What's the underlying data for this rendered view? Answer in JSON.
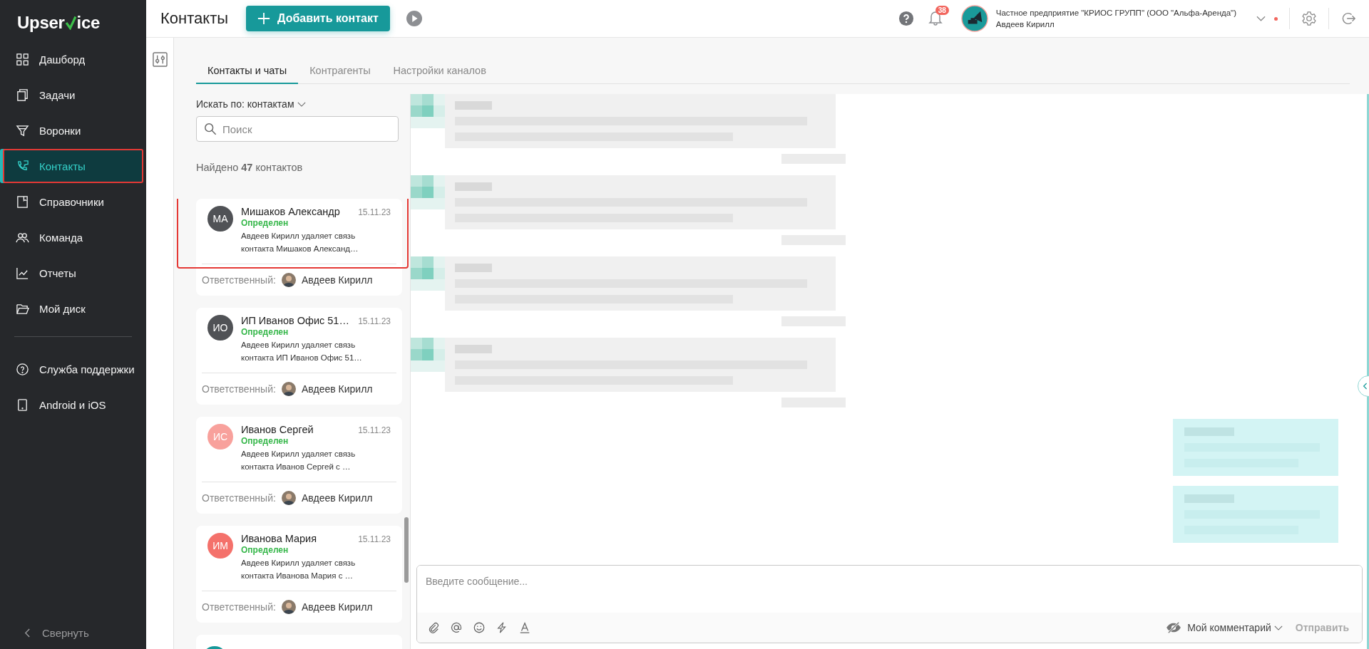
{
  "logo": {
    "before": "Upser",
    "after": "ice"
  },
  "sidebar": {
    "items": [
      {
        "label": "Дашборд",
        "selected": false,
        "highlighted": false
      },
      {
        "label": "Задачи",
        "selected": false,
        "highlighted": false
      },
      {
        "label": "Воронки",
        "selected": false,
        "highlighted": false
      },
      {
        "label": "Контакты",
        "selected": true,
        "highlighted": true
      },
      {
        "label": "Справочники",
        "selected": false,
        "highlighted": false
      },
      {
        "label": "Команда",
        "selected": false,
        "highlighted": false
      },
      {
        "label": "Отчеты",
        "selected": false,
        "highlighted": false
      },
      {
        "label": "Мой диск",
        "selected": false,
        "highlighted": false
      }
    ],
    "bottom_items": [
      {
        "label": "Служба поддержки",
        "selected": false,
        "highlighted": false
      },
      {
        "label": "Android и iOS",
        "selected": false,
        "highlighted": false
      }
    ],
    "collapse": "Свернуть"
  },
  "header": {
    "title": "Контакты",
    "add_button": "Добавить контакт",
    "notifications": "38",
    "company": "Частное предприятие \"КРИОС ГРУПП\" (ООО \"Альфа-Аренда\")",
    "user": "Авдеев Кирилл"
  },
  "tabs": [
    {
      "label": "Контакты и чаты",
      "selected": true
    },
    {
      "label": "Контрагенты",
      "selected": false
    },
    {
      "label": "Настройки каналов",
      "selected": false
    }
  ],
  "search": {
    "filter_label": "Искать по: контактам",
    "placeholder": "Поиск"
  },
  "found": "Найдено **47** контактов",
  "contacts": [
    {
      "kind": "full",
      "initials": "МА",
      "color": "#505256",
      "name": "Мишаков Александр",
      "date": "15.11.23",
      "status": "Определен",
      "preview": "Авдеев Кирилл удаляет связь контакта Мишаков Александ…",
      "responsible_label": "Ответственный:",
      "responsible": "Авдеев Кирилл",
      "highlighted": true
    },
    {
      "kind": "full",
      "initials": "ИО",
      "color": "#505256",
      "name": "ИП Иванов Офис 51…",
      "date": "15.11.23",
      "status": "Определен",
      "preview": "Авдеев Кирилл удаляет связь контакта ИП Иванов Офис 51…",
      "responsible_label": "Ответственный:",
      "responsible": "Авдеев Кирилл",
      "highlighted": false
    },
    {
      "kind": "full",
      "initials": "ИС",
      "color": "#f8a19c",
      "name": "Иванов Сергей",
      "date": "15.11.23",
      "status": "Определен",
      "preview": "Авдеев Кирилл удаляет связь контакта Иванов Сергей с …",
      "responsible_label": "Ответственный:",
      "responsible": "Авдеев Кирилл",
      "highlighted": false
    },
    {
      "kind": "full",
      "initials": "ИМ",
      "color": "#f4716b",
      "name": "Иванова Мария",
      "date": "15.11.23",
      "status": "Определен",
      "preview": "Авдеев Кирилл удаляет связь контакта Иванова Мария с …",
      "responsible_label": "Ответственный:",
      "responsible": "Авдеев Кирилл",
      "highlighted": false
    },
    {
      "kind": "partial",
      "color": "#17999a"
    }
  ],
  "chat": {
    "messages": [
      {
        "kind": "incoming"
      },
      {
        "kind": "incoming"
      },
      {
        "kind": "incoming"
      },
      {
        "kind": "incoming"
      },
      {
        "kind": "outgoing"
      },
      {
        "kind": "outgoing"
      }
    ],
    "composer": {
      "placeholder": "Введите сообщение...",
      "mode": "Мой комментарий",
      "send": "Отправить",
      "send_disabled": true
    }
  }
}
